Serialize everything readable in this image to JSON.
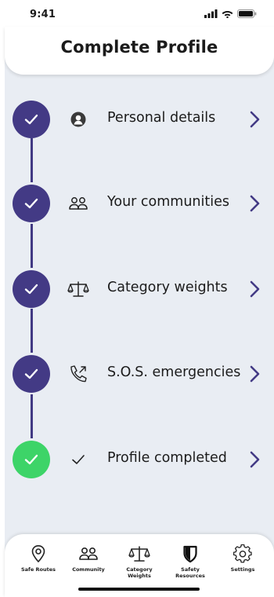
{
  "status_bar": {
    "time": "9:41",
    "icons": [
      "signal-icon",
      "wifi-icon",
      "battery-icon"
    ]
  },
  "header": {
    "title": "Complete Profile"
  },
  "steps": [
    {
      "label": "Personal details",
      "icon": "person-icon",
      "status": "done"
    },
    {
      "label": "Your communities",
      "icon": "people-icon",
      "status": "done"
    },
    {
      "label": "Category weights",
      "icon": "scales-icon",
      "status": "done"
    },
    {
      "label": "S.O.S. emergencies",
      "icon": "phone-call-icon",
      "status": "done"
    },
    {
      "label": "Profile completed",
      "icon": "check-icon",
      "status": "complete"
    }
  ],
  "tabbar": {
    "tabs": [
      {
        "label": "Safe Routes",
        "icon": "location-pin-icon"
      },
      {
        "label": "Community",
        "icon": "people-icon"
      },
      {
        "label": "Category Weights",
        "icon": "scales-icon"
      },
      {
        "label": "Safety Resources",
        "icon": "shield-icon"
      },
      {
        "label": "Settings",
        "icon": "gear-icon"
      }
    ]
  },
  "colors": {
    "step_circle": "#433a85",
    "step_complete": "#3dd468",
    "chevron": "#433a85",
    "background": "#e9edf3"
  }
}
